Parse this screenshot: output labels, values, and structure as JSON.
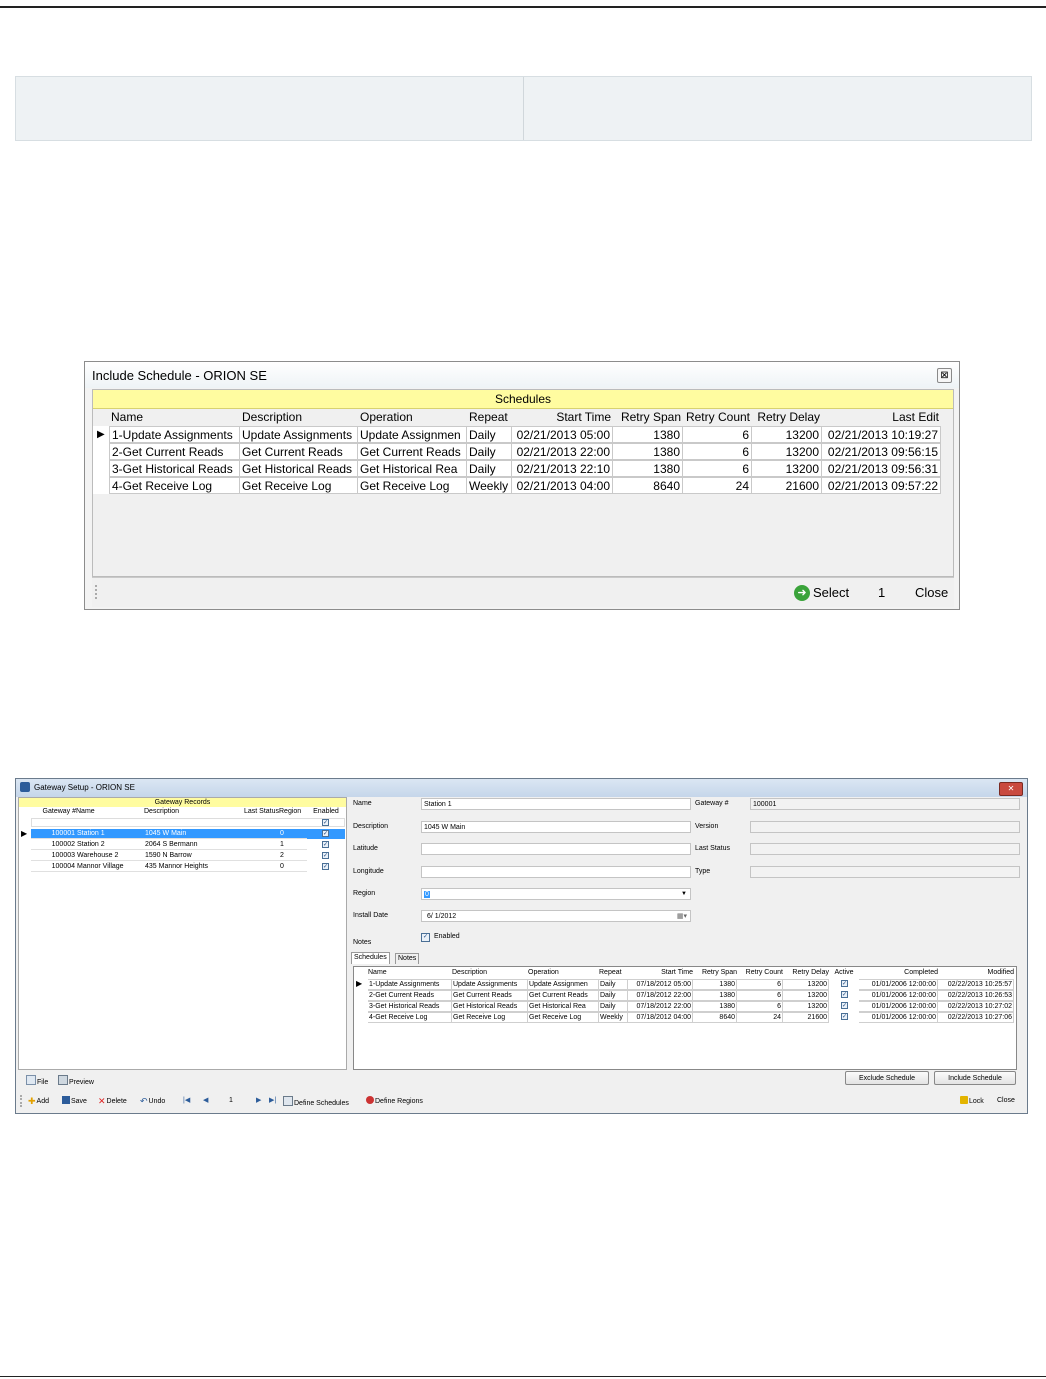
{
  "dialog1": {
    "title": "Include Schedule - ORION SE",
    "close_glyph": "⊠",
    "grid_title": "Schedules",
    "columns": [
      "Name",
      "Description",
      "Operation",
      "Repeat",
      "Start Time",
      "Retry Span",
      "Retry Count",
      "Retry Delay",
      "Last Edit"
    ],
    "rows": [
      [
        "1-Update Assignments",
        "Update Assignments",
        "Update Assignmen",
        "Daily",
        "02/21/2013 05:00",
        "1380",
        "6",
        "13200",
        "02/21/2013 10:19:27"
      ],
      [
        "2-Get Current Reads",
        "Get Current Reads",
        "Get Current Reads",
        "Daily",
        "02/21/2013 22:00",
        "1380",
        "6",
        "13200",
        "02/21/2013 09:56:15"
      ],
      [
        "3-Get Historical Reads",
        "Get Historical Reads",
        "Get Historical Rea",
        "Daily",
        "02/21/2013 22:10",
        "1380",
        "6",
        "13200",
        "02/21/2013 09:56:31"
      ],
      [
        "4-Get Receive Log",
        "Get Receive Log",
        "Get Receive Log",
        "Weekly",
        "02/21/2013 04:00",
        "8640",
        "24",
        "21600",
        "02/21/2013 09:57:22"
      ]
    ],
    "select_label": "Select",
    "count": "1",
    "close_label": "Close"
  },
  "dialog2": {
    "title": "Gateway Setup - ORION SE",
    "close_glyph": "✕",
    "records_title": "Gateway Records",
    "records_columns": [
      "Gateway #",
      "Name",
      "Description",
      "Last Status",
      "Region",
      "Enabled"
    ],
    "records": [
      [
        "100001",
        "Station 1",
        "1045 W Main",
        "",
        "0"
      ],
      [
        "100002",
        "Station 2",
        "2064 S Bermann",
        "",
        "1"
      ],
      [
        "100003",
        "Warehouse 2",
        "1590 N Barrow",
        "",
        "2"
      ],
      [
        "100004",
        "Mannor Village",
        "435 Mannor Heights",
        "",
        "0"
      ]
    ],
    "form": {
      "name_label": "Name",
      "name_value": "Station 1",
      "description_label": "Description",
      "description_value": "1045 W Main",
      "latitude_label": "Latitude",
      "latitude_value": "",
      "longitude_label": "Longitude",
      "longitude_value": "",
      "region_label": "Region",
      "region_value": "0",
      "install_date_label": "Install Date",
      "install_date_value": "6/ 1/2012",
      "enabled_label": "Enabled",
      "notes_label": "Notes",
      "gateway_label": "Gateway #",
      "gateway_value": "100001",
      "version_label": "Version",
      "version_value": "",
      "last_status_label": "Last Status",
      "last_status_value": "",
      "type_label": "Type",
      "type_value": ""
    },
    "tabs": [
      "Schedules",
      "Notes"
    ],
    "sched_columns": [
      "Name",
      "Description",
      "Operation",
      "Repeat",
      "Start Time",
      "Retry Span",
      "Retry Count",
      "Retry Delay",
      "Active",
      "Completed",
      "Modified"
    ],
    "sched_rows": [
      [
        "1-Update Assignments",
        "Update Assignments",
        "Update Assignmen",
        "Daily",
        "07/18/2012 05:00",
        "1380",
        "6",
        "13200",
        "01/01/2006 12:00:00",
        "02/22/2013 10:25:57"
      ],
      [
        "2-Get Current Reads",
        "Get Current Reads",
        "Get Current Reads",
        "Daily",
        "07/18/2012 22:00",
        "1380",
        "6",
        "13200",
        "01/01/2006 12:00:00",
        "02/22/2013 10:26:53"
      ],
      [
        "3-Get Historical Reads",
        "Get Historical Reads",
        "Get Historical Rea",
        "Daily",
        "07/18/2012 22:00",
        "1380",
        "6",
        "13200",
        "01/01/2006 12:00:00",
        "02/22/2013 10:27:02"
      ],
      [
        "4-Get Receive Log",
        "Get Receive Log",
        "Get Receive Log",
        "Weekly",
        "07/18/2012 04:00",
        "8640",
        "24",
        "21600",
        "01/01/2006 12:00:00",
        "02/22/2013 10:27:06"
      ]
    ],
    "exclude_label": "Exclude Schedule",
    "include_label": "Include Schedule",
    "file_label": "File",
    "preview_label": "Preview",
    "toolbar": {
      "add": "Add",
      "save": "Save",
      "delete": "Delete",
      "undo": "Undo",
      "page": "1",
      "define_schedules": "Define Schedules",
      "define_regions": "Define Regions",
      "lock": "Lock",
      "close": "Close"
    }
  },
  "colors": {
    "grid_header": "#fffca0",
    "selection": "#3399ff",
    "close_red": "#c94a3f"
  }
}
